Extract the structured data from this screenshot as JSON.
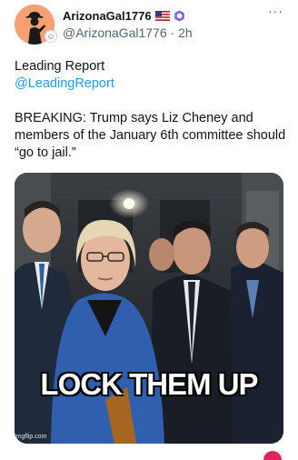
{
  "tweet": {
    "display_name": "ArizonaGal1776",
    "handle": "@ArizonaGal1776",
    "time": "2h",
    "separator": "·",
    "more": "···"
  },
  "body": {
    "line1": "Leading Report",
    "line2": "@LeadingReport",
    "line3": "BREAKING: Trump says Liz Cheney and members of the January 6th committee should “go to jail.”"
  },
  "media": {
    "caption": "LOCK THEM UP",
    "watermark": "imgflip.com"
  },
  "colors": {
    "link": "#1d9bf0",
    "verified": "#7856ff",
    "avatar_bg": "#f7a072"
  }
}
